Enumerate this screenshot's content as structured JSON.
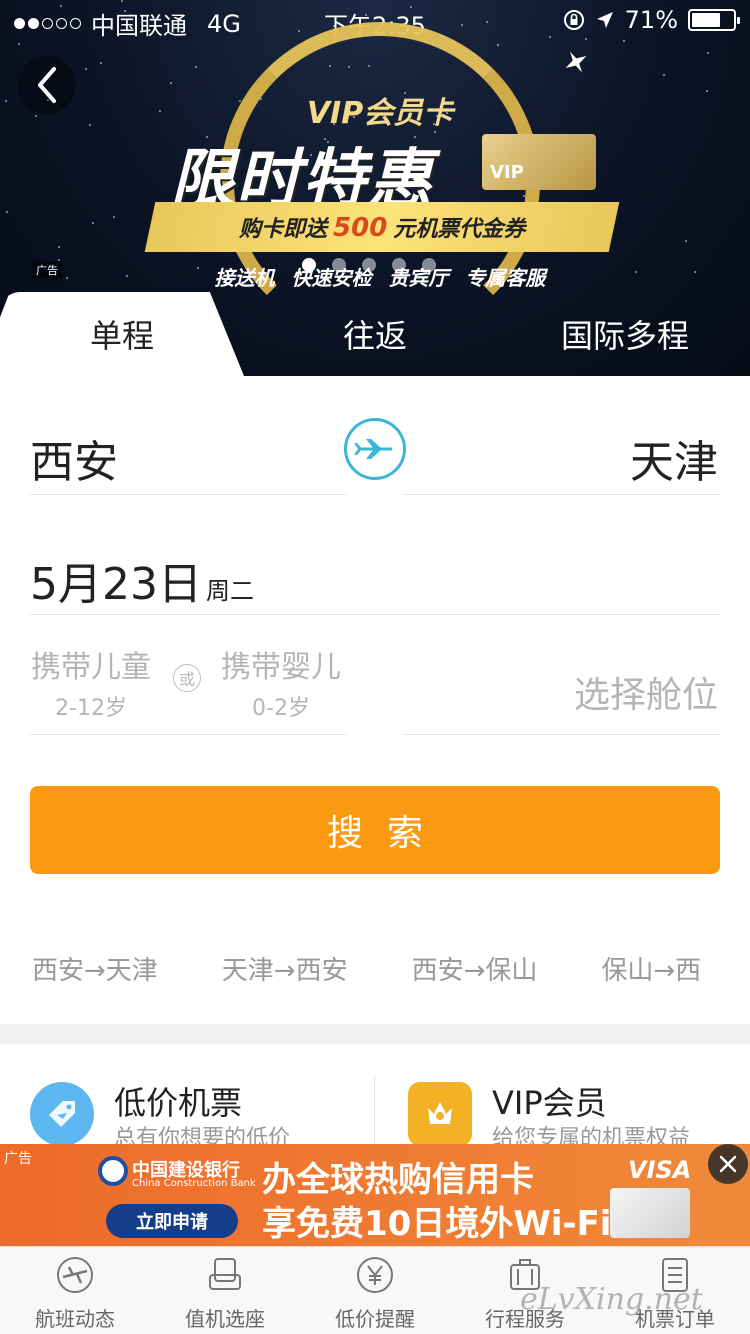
{
  "status_bar": {
    "carrier": "中国联通",
    "network": "4G",
    "time": "下午2:35",
    "battery": "71%",
    "battery_level": 0.71
  },
  "hero_ad": {
    "vip_card_title": "VIP会员卡",
    "promo_title": "限时特惠",
    "card_text": "VIP",
    "ribbon_prefix": "购卡即送",
    "ribbon_amount": "500",
    "ribbon_suffix": "元机票代金券",
    "benefits": "接送机 快速安检 贵宾厅 专属客服",
    "ad_label": "广告",
    "pager_count": 5,
    "pager_active": 0
  },
  "tabs": [
    {
      "label": "单程",
      "active": true
    },
    {
      "label": "往返",
      "active": false
    },
    {
      "label": "国际多程",
      "active": false
    }
  ],
  "form": {
    "from_city": "西安",
    "to_city": "天津",
    "date": "5月23日",
    "weekday": "周二",
    "child_label": "携带儿童",
    "child_age": "2-12岁",
    "or_label": "或",
    "infant_label": "携带婴儿",
    "infant_age": "0-2岁",
    "cabin_placeholder": "选择舱位",
    "search_label": "搜索"
  },
  "history": [
    "西安→天津",
    "天津→西安",
    "西安→保山",
    "保山→西"
  ],
  "promo_cards": [
    {
      "title": "低价机票",
      "subtitle": "总有你想要的低价",
      "icon": "tag-plane-icon",
      "color": "#5cb6f0"
    },
    {
      "title": "VIP会员",
      "subtitle": "给您专属的机票权益",
      "icon": "crown-vip-icon",
      "color": "#f3b126"
    }
  ],
  "banner_ad": {
    "ad_tag": "广告",
    "bank_cn": "中国建设银行",
    "bank_en": "China Construction Bank",
    "apply": "立即申请",
    "line1": "办全球热购信用卡",
    "line2": "享免费10日境外Wi-Fi",
    "visa": "VISA"
  },
  "tabbar": [
    {
      "label": "航班动态",
      "icon": "flight-status-icon"
    },
    {
      "label": "值机选座",
      "icon": "seat-icon"
    },
    {
      "label": "低价提醒",
      "icon": "yen-alert-icon"
    },
    {
      "label": "行程服务",
      "icon": "luggage-icon"
    },
    {
      "label": "机票订单",
      "icon": "order-list-icon"
    }
  ],
  "watermark": "eLvXing.net",
  "colors": {
    "accent": "#fb9a10",
    "swap": "#3bb6d4"
  }
}
